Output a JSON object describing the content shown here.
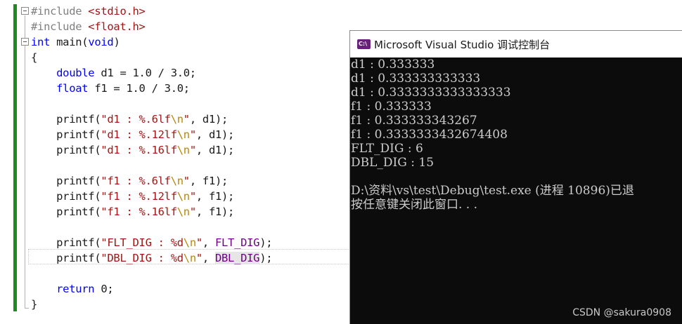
{
  "editor": {
    "lines": [
      {
        "parts": [
          {
            "c": "pp",
            "t": "#include "
          },
          {
            "c": "inc",
            "t": "<stdio.h>"
          }
        ]
      },
      {
        "parts": [
          {
            "c": "pp",
            "t": "#include "
          },
          {
            "c": "inc",
            "t": "<float.h>"
          }
        ]
      },
      {
        "parts": [
          {
            "c": "kw",
            "t": "int"
          },
          {
            "c": "id",
            "t": " main("
          },
          {
            "c": "kw",
            "t": "void"
          },
          {
            "c": "id",
            "t": ")"
          }
        ]
      },
      {
        "parts": [
          {
            "c": "id",
            "t": "{"
          }
        ]
      },
      {
        "parts": [
          {
            "c": "kw",
            "t": "    double"
          },
          {
            "c": "id",
            "t": " d1 = 1.0 / 3.0;"
          }
        ]
      },
      {
        "parts": [
          {
            "c": "kw",
            "t": "    float"
          },
          {
            "c": "id",
            "t": " f1 = 1.0 / 3.0;"
          }
        ]
      },
      {
        "parts": []
      },
      {
        "parts": [
          {
            "c": "id",
            "t": "    printf("
          },
          {
            "c": "str",
            "t": "\"d1 : %.6lf"
          },
          {
            "c": "esc",
            "t": "\\n"
          },
          {
            "c": "str",
            "t": "\""
          },
          {
            "c": "id",
            "t": ", d1);"
          }
        ]
      },
      {
        "parts": [
          {
            "c": "id",
            "t": "    printf("
          },
          {
            "c": "str",
            "t": "\"d1 : %.12lf"
          },
          {
            "c": "esc",
            "t": "\\n"
          },
          {
            "c": "str",
            "t": "\""
          },
          {
            "c": "id",
            "t": ", d1);"
          }
        ]
      },
      {
        "parts": [
          {
            "c": "id",
            "t": "    printf("
          },
          {
            "c": "str",
            "t": "\"d1 : %.16lf"
          },
          {
            "c": "esc",
            "t": "\\n"
          },
          {
            "c": "str",
            "t": "\""
          },
          {
            "c": "id",
            "t": ", d1);"
          }
        ]
      },
      {
        "parts": []
      },
      {
        "parts": [
          {
            "c": "id",
            "t": "    printf("
          },
          {
            "c": "str",
            "t": "\"f1 : %.6lf"
          },
          {
            "c": "esc",
            "t": "\\n"
          },
          {
            "c": "str",
            "t": "\""
          },
          {
            "c": "id",
            "t": ", f1);"
          }
        ]
      },
      {
        "parts": [
          {
            "c": "id",
            "t": "    printf("
          },
          {
            "c": "str",
            "t": "\"f1 : %.12lf"
          },
          {
            "c": "esc",
            "t": "\\n"
          },
          {
            "c": "str",
            "t": "\""
          },
          {
            "c": "id",
            "t": ", f1);"
          }
        ]
      },
      {
        "parts": [
          {
            "c": "id",
            "t": "    printf("
          },
          {
            "c": "str",
            "t": "\"f1 : %.16lf"
          },
          {
            "c": "esc",
            "t": "\\n"
          },
          {
            "c": "str",
            "t": "\""
          },
          {
            "c": "id",
            "t": ", f1);"
          }
        ]
      },
      {
        "parts": []
      },
      {
        "parts": [
          {
            "c": "id",
            "t": "    printf("
          },
          {
            "c": "str",
            "t": "\"FLT_DIG : %d"
          },
          {
            "c": "esc",
            "t": "\\n"
          },
          {
            "c": "str",
            "t": "\""
          },
          {
            "c": "id",
            "t": ", "
          },
          {
            "c": "mac",
            "t": "FLT_DIG"
          },
          {
            "c": "id",
            "t": ");"
          }
        ]
      },
      {
        "parts": [
          {
            "c": "id",
            "t": "    printf("
          },
          {
            "c": "str",
            "t": "\"DBL_DIG : %d"
          },
          {
            "c": "esc",
            "t": "\\n"
          },
          {
            "c": "str",
            "t": "\""
          },
          {
            "c": "id",
            "t": ", "
          },
          {
            "c": "mac mac-hl",
            "t": "DBL_DIG"
          },
          {
            "c": "id",
            "t": ");"
          }
        ]
      },
      {
        "parts": []
      },
      {
        "parts": [
          {
            "c": "kw",
            "t": "    return"
          },
          {
            "c": "id",
            "t": " 0;"
          }
        ]
      },
      {
        "parts": [
          {
            "c": "id",
            "t": "}"
          }
        ]
      }
    ]
  },
  "console": {
    "icon_label": "C:\\",
    "title": "Microsoft Visual Studio 调试控制台",
    "output": [
      "d1 : 0.333333",
      "d1 : 0.333333333333",
      "d1 : 0.3333333333333333",
      "f1 : 0.333333",
      "f1 : 0.333333343267",
      "f1 : 0.3333333432674408",
      "FLT_DIG : 6",
      "DBL_DIG : 15",
      "",
      "D:\\资料\\vs\\test\\Debug\\test.exe (进程 10896)已退",
      "按任意键关闭此窗口. . ."
    ]
  },
  "watermark": "CSDN @sakura0908"
}
